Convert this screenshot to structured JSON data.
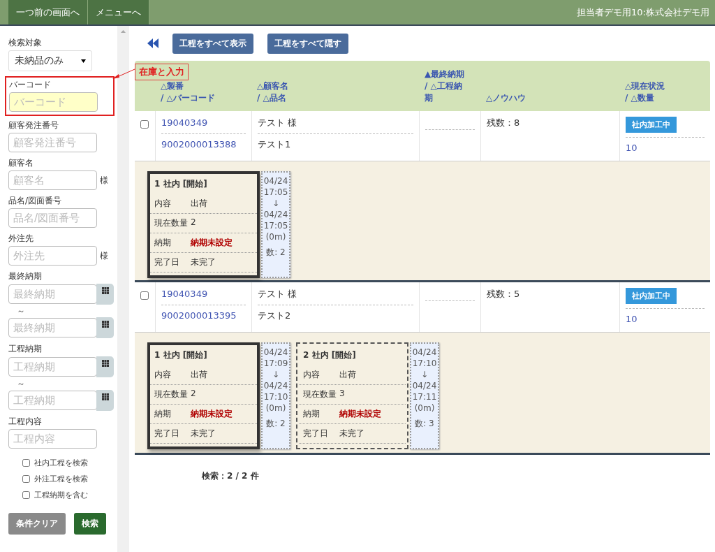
{
  "header": {
    "nav_buttons": [
      "一つ前の画面へ",
      "メニューへ"
    ],
    "user": "担当者デモ用10:株式会社デモ用"
  },
  "sidebar": {
    "fields": [
      {
        "kind": "select",
        "label": "検索対象",
        "value": "未納品のみ",
        "highlighted": false
      },
      {
        "kind": "text",
        "label": "バーコード",
        "placeholder": "バーコード",
        "highlighted": true
      },
      {
        "kind": "text",
        "label": "顧客発注番号",
        "placeholder": "顧客発注番号",
        "highlighted": false
      },
      {
        "kind": "text",
        "label": "顧客名",
        "placeholder": "顧客名",
        "suffix": "様",
        "highlighted": false
      },
      {
        "kind": "text",
        "label": "品名/図面番号",
        "placeholder": "品名/図面番号",
        "highlighted": false
      },
      {
        "kind": "text",
        "label": "外注先",
        "placeholder": "外注先",
        "suffix": "様",
        "highlighted": false
      },
      {
        "kind": "date_range",
        "label": "最終納期",
        "placeholder": "最終納期",
        "separator": "～",
        "placeholder_to": "最終納期",
        "highlighted": false
      },
      {
        "kind": "date_range",
        "label": "工程納期",
        "placeholder": "工程納期",
        "separator": "～",
        "placeholder_to": "工程納期",
        "highlighted": false
      },
      {
        "kind": "text",
        "label": "工程内容",
        "placeholder": "工程内容",
        "highlighted": false
      }
    ],
    "checkboxes": [
      {
        "label": "社内工程を検索",
        "checked": false
      },
      {
        "label": "外注工程を検索",
        "checked": false
      },
      {
        "label": "工程納期を含む",
        "checked": false
      }
    ],
    "buttons": [
      {
        "label": "条件クリア",
        "kind": "secondary"
      },
      {
        "label": "検索",
        "kind": "primary"
      }
    ]
  },
  "annotation": {
    "label": "在庫と入力"
  },
  "toolbar": {
    "buttons": [
      "工程をすべて表示",
      "工程をすべて隠す"
    ]
  },
  "table": {
    "columns": [
      {
        "lines": [
          "△製番",
          "/ △バーコード"
        ]
      },
      {
        "lines": [
          "△顧客名",
          "/ △品名"
        ]
      },
      {
        "lines": [
          "▲最終納期",
          "/ △工程納",
          "期"
        ]
      },
      {
        "lines": [
          "△ノウハウ"
        ]
      },
      {
        "lines": [
          "△現在状況",
          "/ △数量"
        ]
      }
    ],
    "rows": [
      {
        "checked": false,
        "seiban": "19040349",
        "barcode": "9002000013388",
        "customer": "テスト 様",
        "product": "テスト1",
        "knowhow": "残数：8",
        "status": "社内加工中",
        "quantity": "10",
        "processes": [
          {
            "title": "1 社内 [開始]",
            "active": true,
            "fields": [
              {
                "label": "内容",
                "value": "出荷",
                "kind": "normal"
              },
              {
                "label": "現在数量",
                "value": "2",
                "kind": "normal"
              },
              {
                "label": "納期",
                "value": "納期未設定",
                "kind": "alert"
              },
              {
                "label": "完了日",
                "value": "未完了",
                "kind": "normal"
              }
            ],
            "time": {
              "start_date": "04/24",
              "start_time": "17:05",
              "arrow": "↓",
              "end_date": "04/24",
              "end_time": "17:05",
              "duration": "(0m)",
              "count": "数: 2"
            }
          }
        ]
      },
      {
        "checked": false,
        "seiban": "19040349",
        "barcode": "9002000013395",
        "customer": "テスト 様",
        "product": "テスト2",
        "knowhow": "残数：5",
        "status": "社内加工中",
        "quantity": "10",
        "processes": [
          {
            "title": "1 社内 [開始]",
            "active": true,
            "fields": [
              {
                "label": "内容",
                "value": "出荷",
                "kind": "normal"
              },
              {
                "label": "現在数量",
                "value": "2",
                "kind": "normal"
              },
              {
                "label": "納期",
                "value": "納期未設定",
                "kind": "alert"
              },
              {
                "label": "完了日",
                "value": "未完了",
                "kind": "normal"
              }
            ],
            "time": {
              "start_date": "04/24",
              "start_time": "17:09",
              "arrow": "↓",
              "end_date": "04/24",
              "end_time": "17:10",
              "duration": "(0m)",
              "count": "数: 2"
            }
          },
          {
            "title": "2 社内 [開始]",
            "active": false,
            "fields": [
              {
                "label": "内容",
                "value": "出荷",
                "kind": "normal"
              },
              {
                "label": "現在数量",
                "value": "3",
                "kind": "normal"
              },
              {
                "label": "納期",
                "value": "納期未設定",
                "kind": "alert"
              },
              {
                "label": "完了日",
                "value": "未完了",
                "kind": "normal"
              }
            ],
            "time": {
              "start_date": "04/24",
              "start_time": "17:10",
              "arrow": "↓",
              "end_date": "04/24",
              "end_time": "17:11",
              "duration": "(0m)",
              "count": "数: 3"
            }
          }
        ]
      }
    ]
  },
  "footer": {
    "result": "検索：2 / 2 件"
  }
}
